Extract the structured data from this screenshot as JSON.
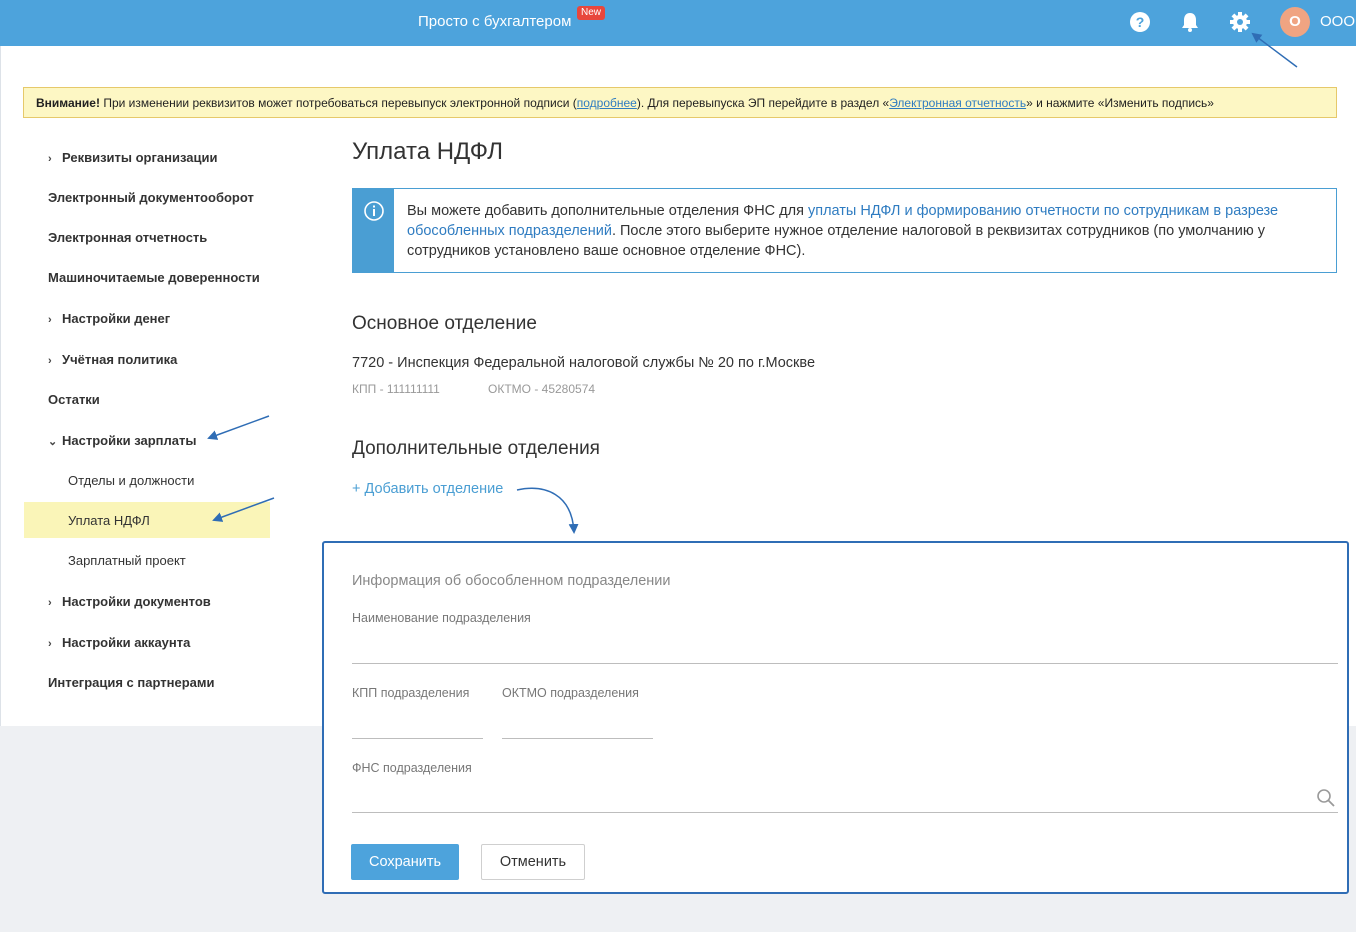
{
  "header": {
    "brand": "Просто с бухгалтером",
    "new_badge": "New",
    "avatar_letter": "О",
    "org_name": "ООО",
    "icons": [
      "help-icon",
      "bell-icon",
      "gear-icon"
    ]
  },
  "warning": {
    "bold": "Внимание!",
    "text1": " При изменении реквизитов может потребоваться перевыпуск электронной подписи (",
    "link1": "подробнее",
    "text2": "). Для перевыпуска ЭП перейдите в раздел «",
    "link2": "Электронная отчетность",
    "text3": "» и нажмите «Изменить подпись»"
  },
  "sidebar": {
    "items": [
      {
        "label": "Реквизиты организации"
      },
      {
        "label": "Электронный документооборот"
      },
      {
        "label": "Электронная отчетность"
      },
      {
        "label": "Машиночитаемые доверенности"
      },
      {
        "label": "Настройки денег"
      },
      {
        "label": "Учётная политика"
      },
      {
        "label": "Остатки"
      },
      {
        "label": "Настройки зарплаты"
      },
      {
        "label": "Отделы и должности"
      },
      {
        "label": "Уплата НДФЛ"
      },
      {
        "label": "Зарплатный проект"
      },
      {
        "label": "Настройки документов"
      },
      {
        "label": "Настройки аккаунта"
      },
      {
        "label": "Интеграция с партнерами"
      }
    ]
  },
  "main": {
    "title": "Уплата НДФЛ",
    "info": {
      "text1": "Вы можете добавить дополнительные отделения ФНС для ",
      "link": "уплаты НДФЛ и формированию отчетности по сотрудникам в разрезе обособленных подразделений",
      "text2": ". После этого выберите нужное отделение налоговой в реквизитах сотрудников (по умолчанию у сотрудников установлено ваше основное отделение ФНС)."
    },
    "main_dept_title": "Основное отделение",
    "main_dept_name": "7720 - Инспекция Федеральной налоговой службы № 20 по г.Москве",
    "kpp": "КПП - 111111111",
    "oktmo": "ОКТМО - 45280574",
    "extra_title": "Дополнительные отделения",
    "add_link": "+ Добавить отделение"
  },
  "form": {
    "title": "Информация об обособленном подразделении",
    "name_label": "Наименование подразделения",
    "kpp_label": "КПП подразделения",
    "oktmo_label": "ОКТМО подразделения",
    "fns_label": "ФНС подразделения",
    "name_value": "",
    "kpp_value": "",
    "oktmo_value": "",
    "fns_value": "",
    "save": "Сохранить",
    "cancel": "Отменить"
  },
  "colors": {
    "topbar": "#4da3dc",
    "accent": "#4a9ed3",
    "annotation": "#2f6db5",
    "active_item": "#faf5b8"
  }
}
